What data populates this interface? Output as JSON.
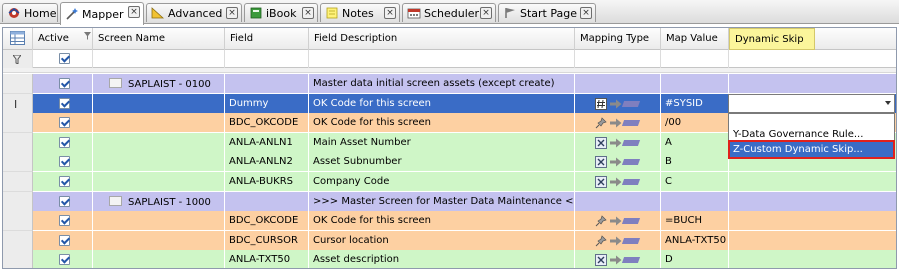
{
  "tabs": [
    {
      "label": "Home",
      "icon": "home-icon",
      "active": false
    },
    {
      "label": "Mapper",
      "icon": "wand-icon",
      "active": true
    },
    {
      "label": "Advanced",
      "icon": "ruler-icon",
      "active": false
    },
    {
      "label": "iBook",
      "icon": "book-icon",
      "active": false
    },
    {
      "label": "Notes",
      "icon": "note-icon",
      "active": false
    },
    {
      "label": "Scheduler",
      "icon": "scheduler-icon",
      "active": false
    },
    {
      "label": "Start Page",
      "icon": "start-page-icon",
      "active": false
    }
  ],
  "close_glyph": "×",
  "columns": {
    "active": "Active",
    "screen_name": "Screen Name",
    "field": "Field",
    "field_description": "Field Description",
    "mapping_type": "Mapping Type",
    "map_value": "Map Value",
    "dynamic_skip": "Dynamic Skip"
  },
  "rows": [
    {
      "kind": "group",
      "screen": "SAPLAIST - 0100",
      "field": "",
      "description": "Master data initial screen assets (except create)",
      "mapping": "",
      "value": ""
    },
    {
      "kind": "selected",
      "screen": "",
      "field": "Dummy",
      "description": "OK Code for this screen",
      "mapping": "hash-icon",
      "value": "#SYSID"
    },
    {
      "kind": "orange",
      "screen": "",
      "field": "BDC_OKCODE",
      "description": "OK Code for this screen",
      "mapping": "pin-icon",
      "value": "/00"
    },
    {
      "kind": "green",
      "screen": "",
      "field": "ANLA-ANLN1",
      "description": "Main Asset Number",
      "mapping": "excel-icon",
      "value": "A"
    },
    {
      "kind": "green",
      "screen": "",
      "field": "ANLA-ANLN2",
      "description": "Asset Subnumber",
      "mapping": "excel-icon",
      "value": "B"
    },
    {
      "kind": "green",
      "screen": "",
      "field": "ANLA-BUKRS",
      "description": "Company Code",
      "mapping": "excel-icon",
      "value": "C"
    },
    {
      "kind": "group",
      "screen": "SAPLAIST - 1000",
      "field": "",
      "description": ">>> Master Screen for Master Data Maintenance <<<",
      "mapping": "",
      "value": ""
    },
    {
      "kind": "orange",
      "screen": "",
      "field": "BDC_OKCODE",
      "description": "OK Code for this screen",
      "mapping": "pin-icon",
      "value": "=BUCH"
    },
    {
      "kind": "orange",
      "screen": "",
      "field": "BDC_CURSOR",
      "description": "Cursor location",
      "mapping": "pin-icon",
      "value": "ANLA-TXT50"
    },
    {
      "kind": "green",
      "screen": "",
      "field": "ANLA-TXT50",
      "description": "Asset description",
      "mapping": "excel-icon",
      "value": "D"
    }
  ],
  "dropdown": {
    "value": "",
    "options": [
      "Y-Data Governance Rule...",
      "Z-Custom Dynamic Skip..."
    ],
    "highlighted": "Z-Custom Dynamic Skip..."
  },
  "colors": {
    "group_row": "#c4c2ef",
    "selected_row": "#3a6cc6",
    "orange_row": "#fdd0a2",
    "green_row": "#cff6c7",
    "dynamic_skip_header": "#fbf59b",
    "highlight_box": "#e0211c"
  }
}
